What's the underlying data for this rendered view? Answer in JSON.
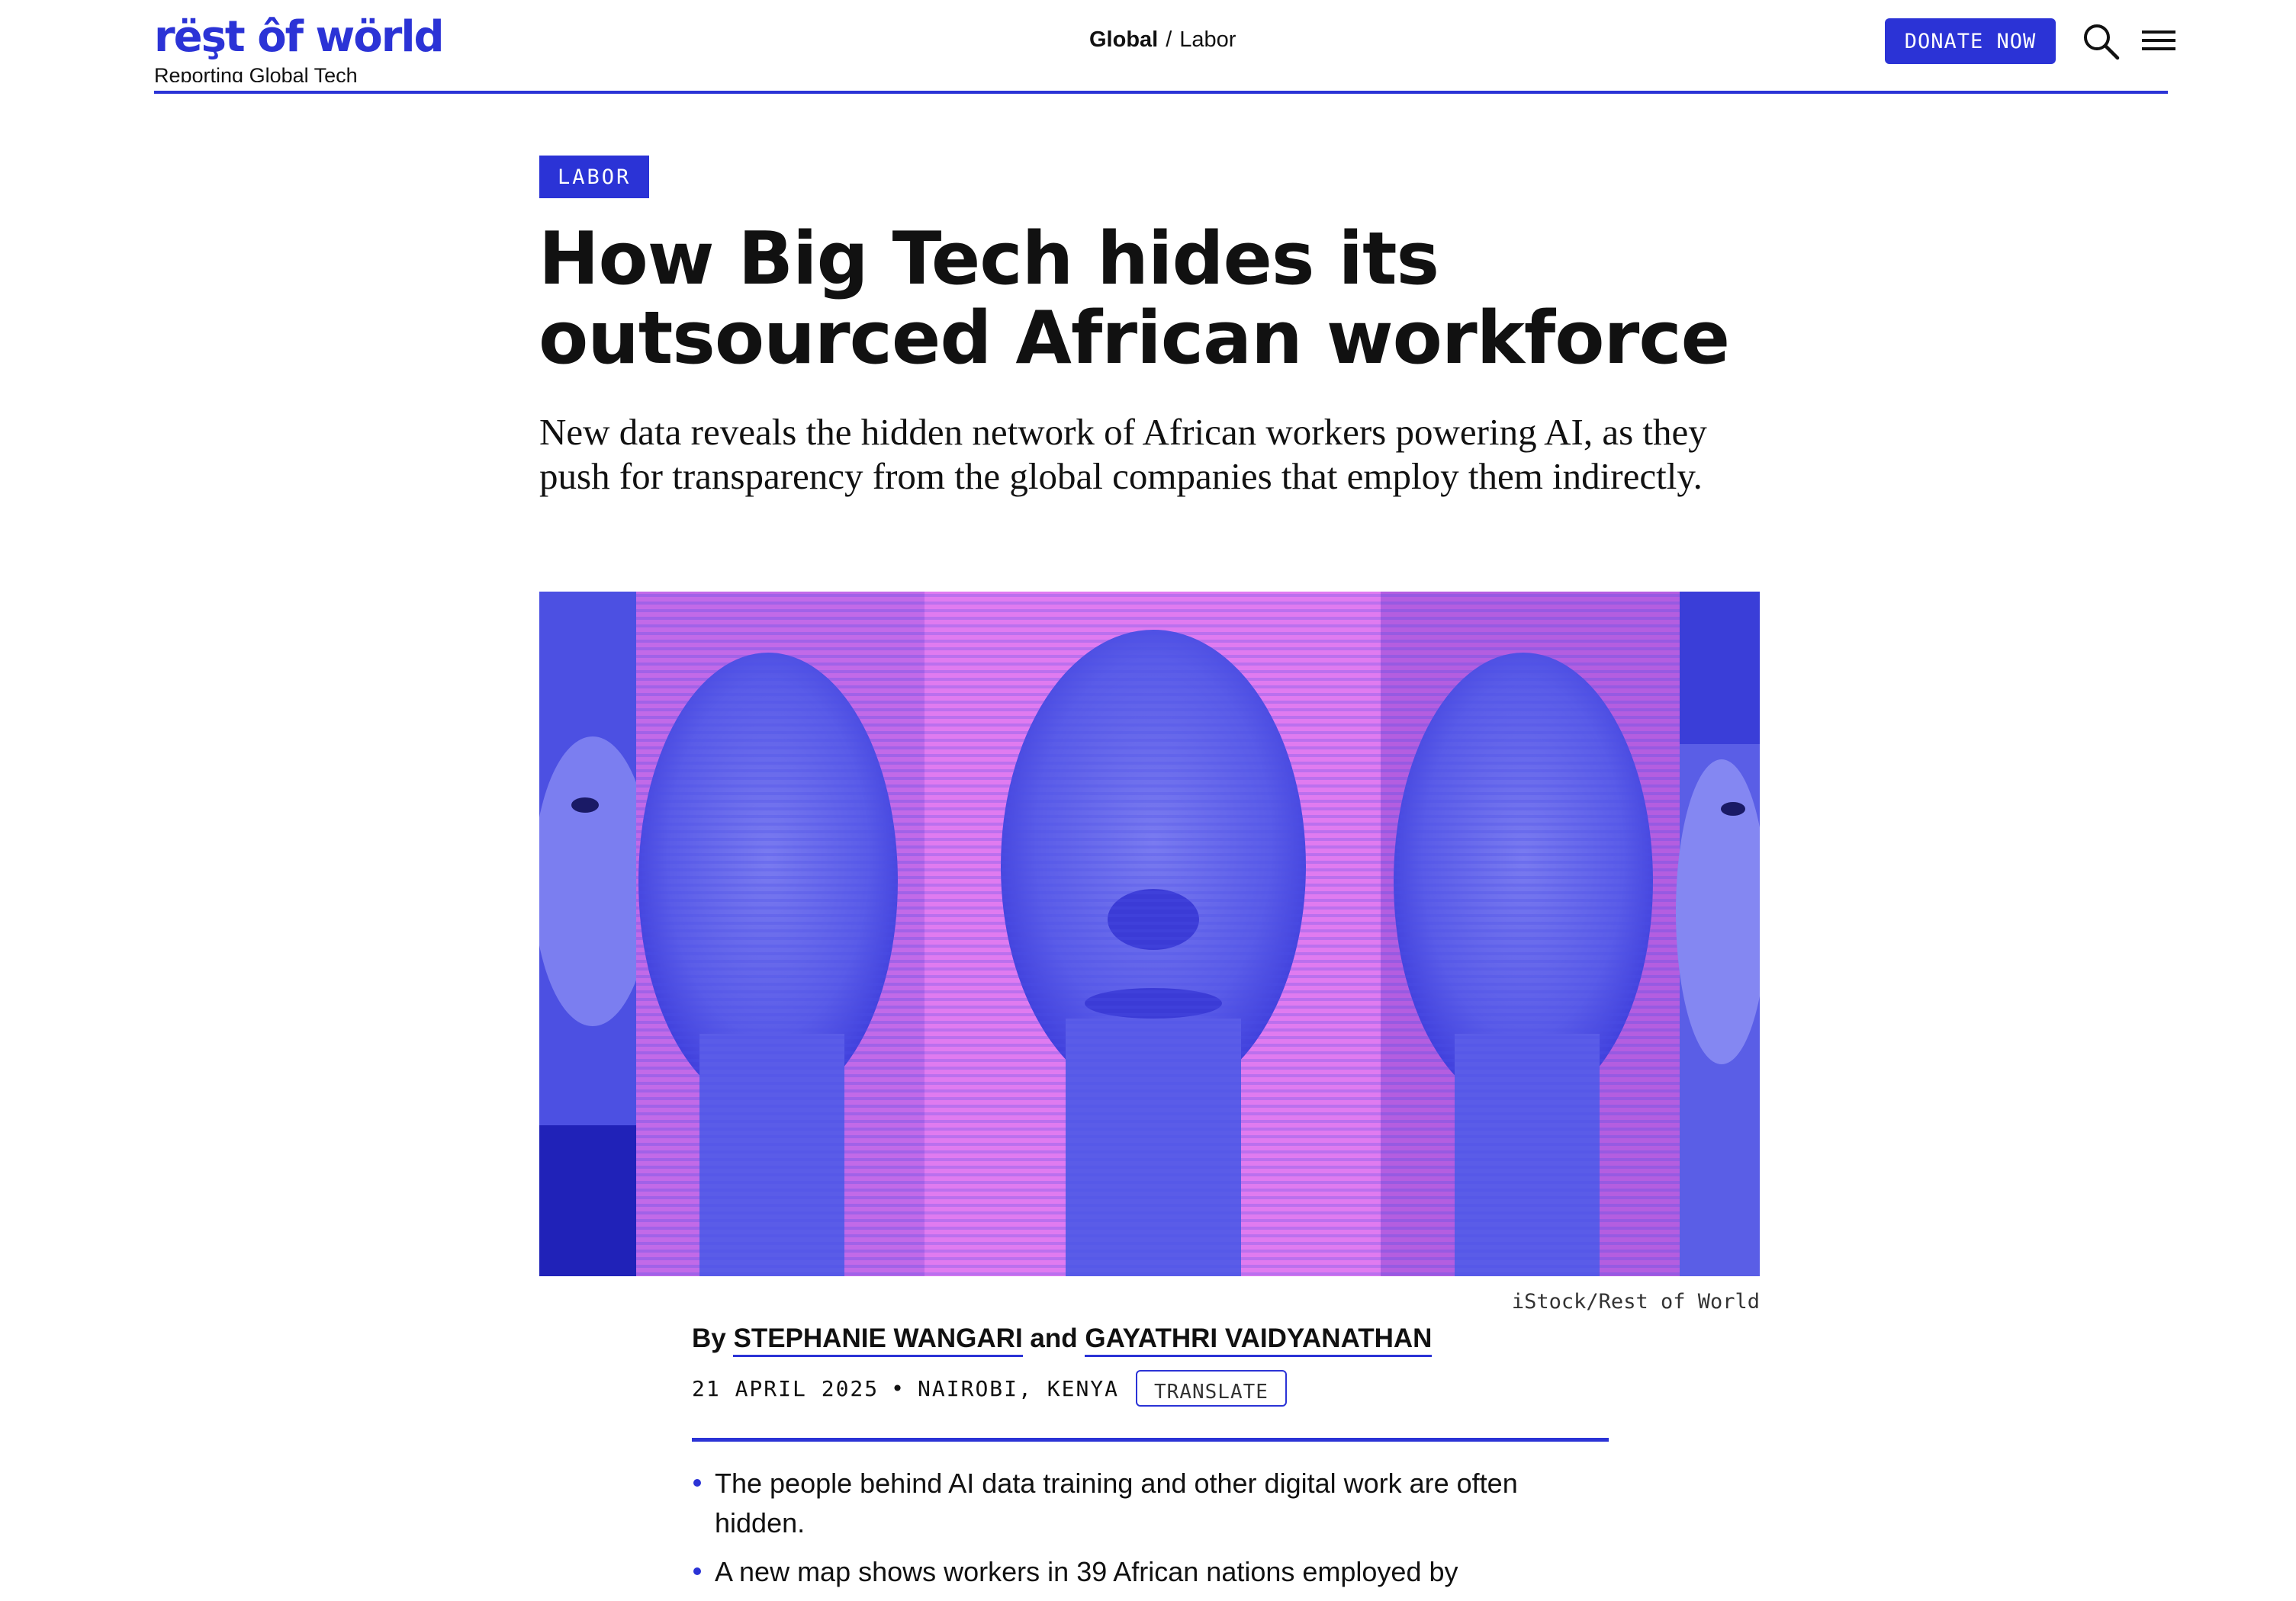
{
  "brand": {
    "wordmark": "rëşt ôf wörld",
    "tagline": "Reporting Global Tech",
    "accent_color": "#2b33d6",
    "hero_bg_color": "#c96ee8"
  },
  "breadcrumb": {
    "current": "Global",
    "separator": "/",
    "section": "Labor"
  },
  "header_actions": {
    "donate_label": "DONATE NOW",
    "search_icon": "search-icon",
    "menu_icon": "hamburger-menu-icon"
  },
  "article": {
    "tag": "LABOR",
    "headline": "How Big Tech hides its outsourced African workforce",
    "dek": "New data reveals the hidden network of African workers powering AI, as they push for transparency from the global companies that employ them indirectly.",
    "hero_image_caption": "iStock/Rest of World",
    "byline": {
      "prefix": "By",
      "author1": "STEPHANIE WANGARI",
      "conjunction": "and",
      "author2": "GAYATHRI VAIDYANATHAN"
    },
    "meta": {
      "date": "21 APRIL 2025",
      "separator": "•",
      "location": "NAIROBI, KENYA",
      "translate_label": "TRANSLATE"
    },
    "summary": [
      "The people behind AI data training and other digital work are often hidden.",
      "A new map shows workers in 39 African nations employed by"
    ]
  }
}
